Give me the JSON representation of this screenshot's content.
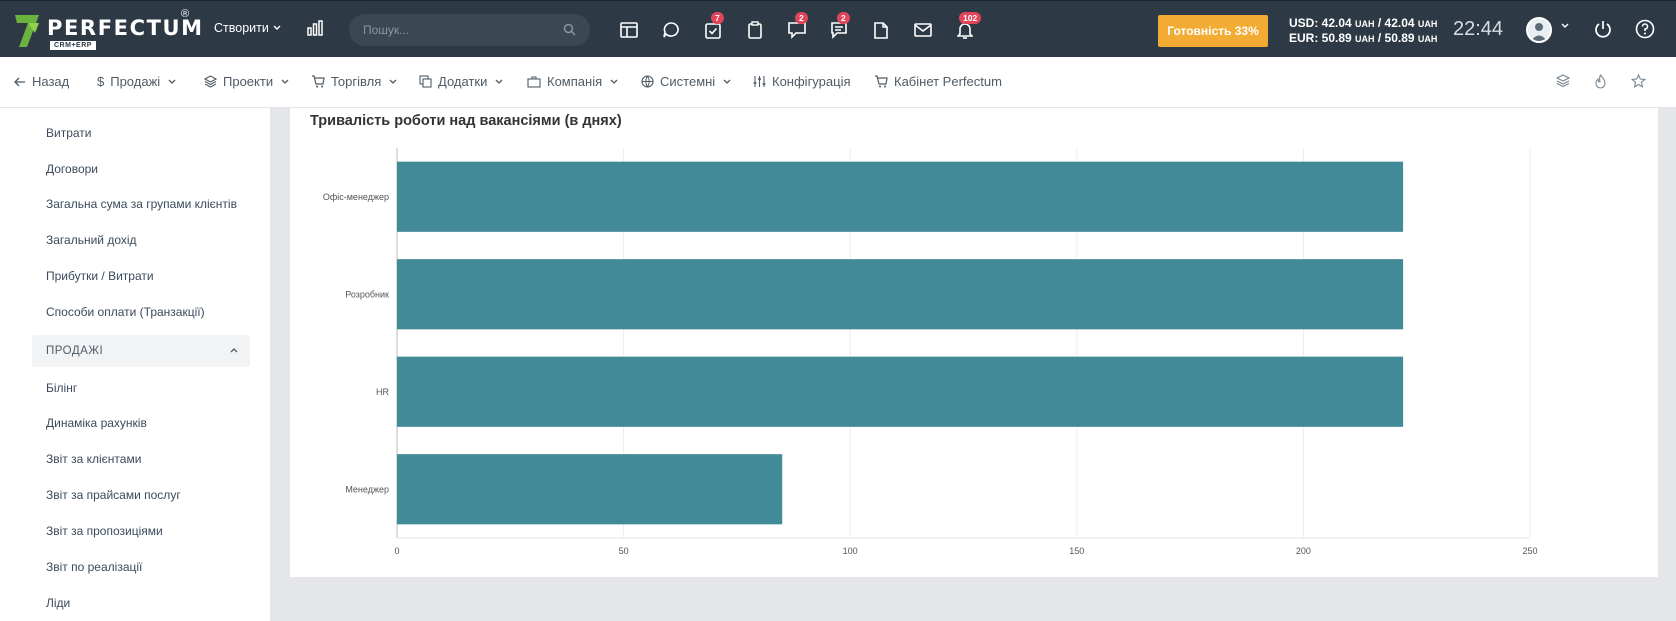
{
  "topbar": {
    "logo_text": "PERFECTUM",
    "logo_sub": "CRM+ERP",
    "logo_reg": "®",
    "create_label": "Створити",
    "search_placeholder": "Пошук...",
    "badges": {
      "tasks": "7",
      "chat": "2",
      "discussions": "2",
      "notifications": "102"
    },
    "ready_label": "Готовність 33%",
    "rates": {
      "usd_prefix": "USD: 42.04",
      "usd_mid": " / 42.04",
      "eur_prefix": "EUR: 50.89",
      "eur_mid": " / 50.89",
      "unit": "UAH"
    },
    "clock": "22:44"
  },
  "navbar": {
    "back": "Назад",
    "sales": "Продажі",
    "projects": "Проекти",
    "trade": "Торгівля",
    "addons": "Додатки",
    "company": "Компанія",
    "system": "Системні",
    "config": "Конфігурація",
    "cabinet": "Кабінет Perfectum"
  },
  "sidebar": {
    "items_top": [
      "Витрати",
      "Договори",
      "Загальна сума за групами клієнтів",
      "Загальний дохід",
      "Прибутки / Витрати",
      "Способи оплати (Транзакції)"
    ],
    "section": "ПРОДАЖІ",
    "items_bottom": [
      "Білінг",
      "Динаміка рахунків",
      "Звіт за клієнтами",
      "Звіт за прайсами послуг",
      "Звіт за пропозиціями",
      "Звіт по реалізації",
      "Ліди"
    ]
  },
  "card": {
    "title": "Тривалість роботи над вакансіями (в днях)"
  },
  "chart_data": {
    "type": "bar",
    "orientation": "horizontal",
    "categories": [
      "Офіс-менеджер",
      "Розробник",
      "HR",
      "Менеджер"
    ],
    "values": [
      222,
      222,
      222,
      85
    ],
    "xlim": [
      0,
      250
    ],
    "xticks": [
      0,
      50,
      100,
      150,
      200,
      250
    ],
    "grid": true,
    "color": "#438a99"
  },
  "colors": {
    "topbar": "#2d3a45",
    "accent": "#f3ac33",
    "badge": "#e0455a",
    "bar": "#438a99"
  }
}
